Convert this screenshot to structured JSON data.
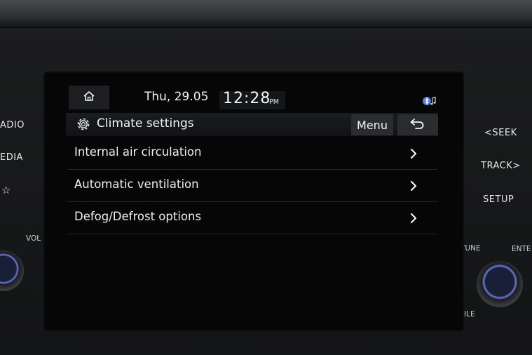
{
  "bezel": {
    "left_buttons": [
      "ADIO",
      "EDIA",
      "☆"
    ],
    "left_vol_label": "VOL",
    "right_buttons": [
      "<SEEK",
      "TRACK>",
      "SETUP"
    ],
    "tune_label": "TUNE",
    "enter_label": "ENTE",
    "file_label": "FILE"
  },
  "status_bar": {
    "date": "Thu, 29.05",
    "time": "12:28",
    "ampm": "PM",
    "icons": {
      "home": "home-icon",
      "bluetooth_audio": "bluetooth-audio-icon"
    }
  },
  "header": {
    "icon": "gear-icon",
    "title": "Climate settings",
    "menu_label": "Menu",
    "back_icon": "back-arrow-icon"
  },
  "menu_items": [
    {
      "label": "Internal air circulation",
      "icon": "chevron-right-icon"
    },
    {
      "label": "Automatic ventilation",
      "icon": "chevron-right-icon"
    },
    {
      "label": "Defog/Defrost options",
      "icon": "chevron-right-icon"
    }
  ],
  "colors": {
    "screen_bg": "#060607",
    "text": "#efefef",
    "bluetooth_accent": "#4f7fe6",
    "knob_ring": "#6f7bd8"
  }
}
